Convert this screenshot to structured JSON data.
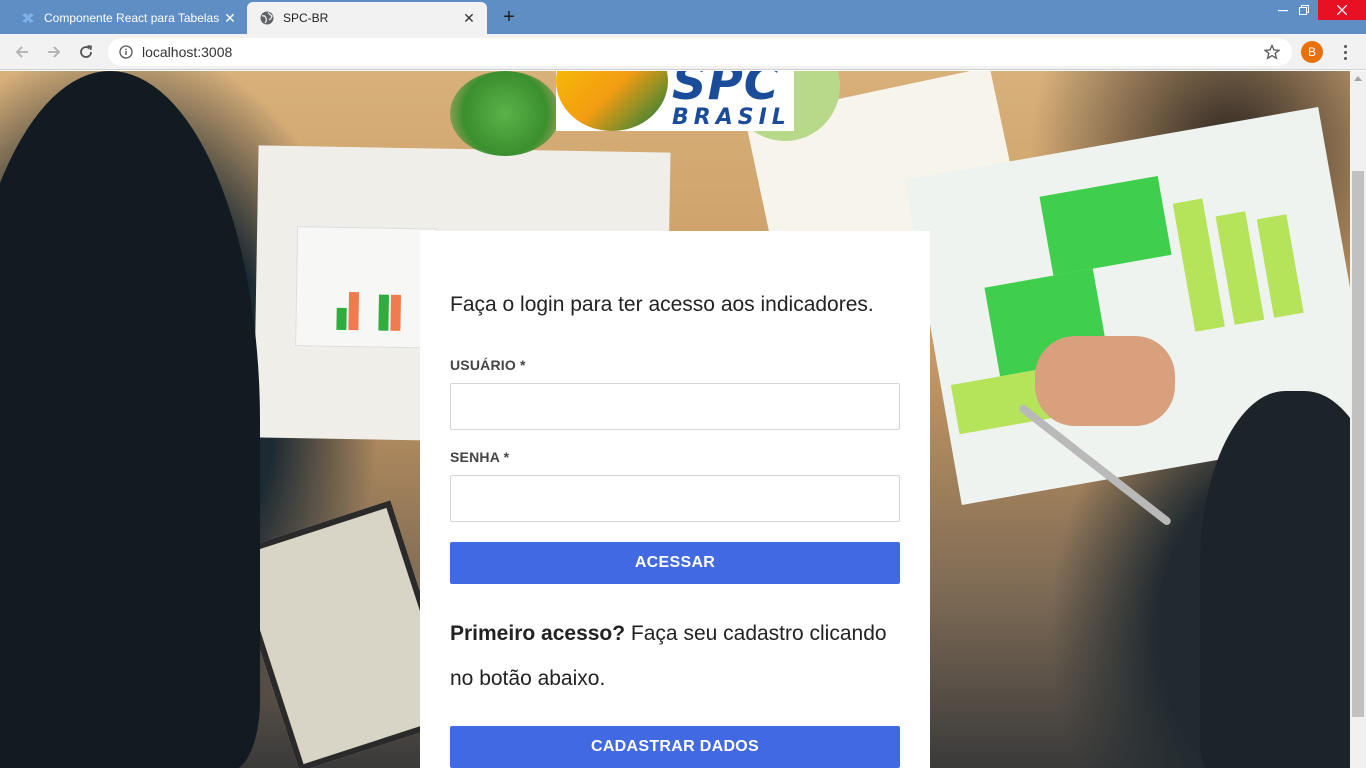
{
  "browser": {
    "tabs": [
      {
        "title": "Componente React para Tabelas",
        "favicon": "react-docs-icon",
        "active": false
      },
      {
        "title": "SPC-BR",
        "favicon": "globe-icon",
        "active": true
      }
    ],
    "new_tab_label": "+",
    "address": "localhost:3008",
    "profile_initial": "B",
    "profile_color": "#e8710a",
    "tabbar_color": "#5e8ec4"
  },
  "page": {
    "logo": {
      "line1": "SPC",
      "line2": "BRASIL"
    },
    "login": {
      "heading": "Faça o login para ter acesso aos indicadores.",
      "user_label": "USUÁRIO *",
      "user_value": "",
      "password_label": "SENHA *",
      "password_value": "",
      "submit_label": "ACESSAR"
    },
    "first_access": {
      "bold": "Primeiro acesso?",
      "text": " Faça seu cadastro clicando no botão abaixo."
    },
    "signup_label": "CADASTRAR DADOS",
    "accent_color": "#4169e1"
  }
}
